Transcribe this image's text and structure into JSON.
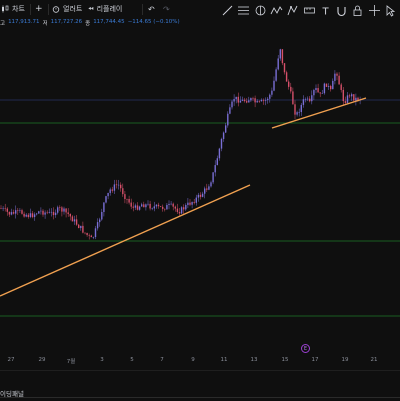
{
  "toolbar": {
    "chart_label": "차트",
    "alert_label": "얼러트",
    "replay_label": "리플레이",
    "drawing_tools": [
      "trend-line-icon",
      "measure-icon",
      "fib-icon",
      "brush-icon",
      "pattern-icon",
      "ruler-icon",
      "text-icon",
      "magnet-icon",
      "lock-icon",
      "crosshair-icon",
      "cursor-icon"
    ]
  },
  "ohlc": {
    "high_label": "고",
    "high_value": "117,913.71",
    "low_label": "저",
    "low_value": "117,727.26",
    "close_label": "종",
    "close_value": "117,744.45",
    "change": "−114.65 (−0.10%)"
  },
  "x_axis": [
    "27",
    "29",
    "7월",
    "3",
    "5",
    "7",
    "9",
    "11",
    "13",
    "15",
    "17",
    "19",
    "21"
  ],
  "event_badge": "E",
  "footer": {
    "panel_label": "이딩패널"
  },
  "colors": {
    "background": "#0f0f0f",
    "candle_up": "#7a6fd6",
    "candle_down": "#d6506a",
    "trendline": "#f0a050",
    "hline_green": "#1e7a2a",
    "hline_navy": "#2a3566",
    "axis_text": "#8a8e99",
    "value_blue": "#3a7bd5"
  }
}
